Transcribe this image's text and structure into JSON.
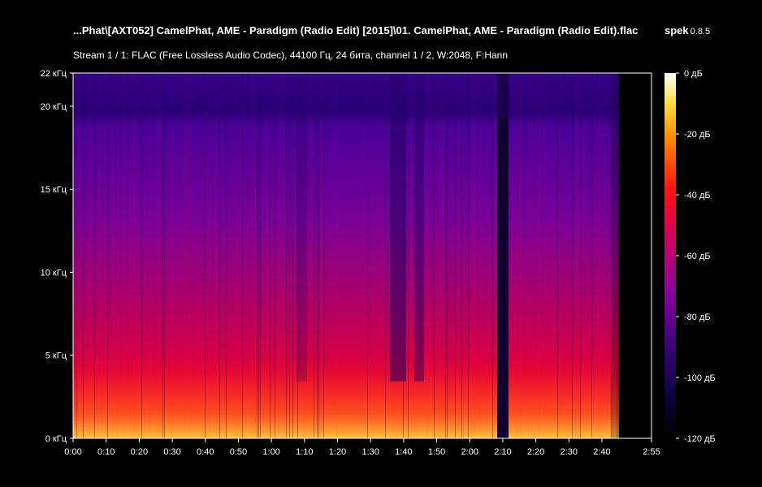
{
  "window": {
    "title": "...Phat\\[AXT052] CamelPhat, AME - Paradigm (Radio Edit) [2015]\\01. CamelPhat, AME - Paradigm (Radio Edit).flac",
    "app_name": "spek",
    "app_version": "0.8.5",
    "stream_info": "Stream 1 / 1: FLAC (Free Lossless Audio Codec), 44100 Гц, 24 бита, channel 1 / 2, W:2048, F:Hann"
  },
  "axes": {
    "frequency_ticks": [
      "22 кГц",
      "20 кГц",
      "15 кГц",
      "10 кГц",
      "5 кГц",
      "0 кГц"
    ],
    "frequency_values_khz": [
      22,
      20,
      15,
      10,
      5,
      0
    ],
    "time_ticks": [
      "0:00",
      "0:10",
      "0:20",
      "0:30",
      "0:40",
      "0:50",
      "1:00",
      "1:10",
      "1:20",
      "1:30",
      "1:40",
      "1:50",
      "2:00",
      "2:10",
      "2:20",
      "2:30",
      "2:40",
      "2:55"
    ],
    "time_values_s": [
      0,
      10,
      20,
      30,
      40,
      50,
      60,
      70,
      80,
      90,
      100,
      110,
      120,
      130,
      140,
      150,
      160,
      175
    ],
    "duration_s": 175,
    "max_freq_khz": 22
  },
  "colorbar": {
    "labels": [
      "0 дБ",
      "-20 дБ",
      "-40 дБ",
      "-60 дБ",
      "-80 дБ",
      "-100 дБ",
      "-120 дБ"
    ],
    "values_db": [
      0,
      -20,
      -40,
      -60,
      -80,
      -100,
      -120
    ]
  },
  "colors": {
    "background": "#000000",
    "text": "#ffffff"
  }
}
